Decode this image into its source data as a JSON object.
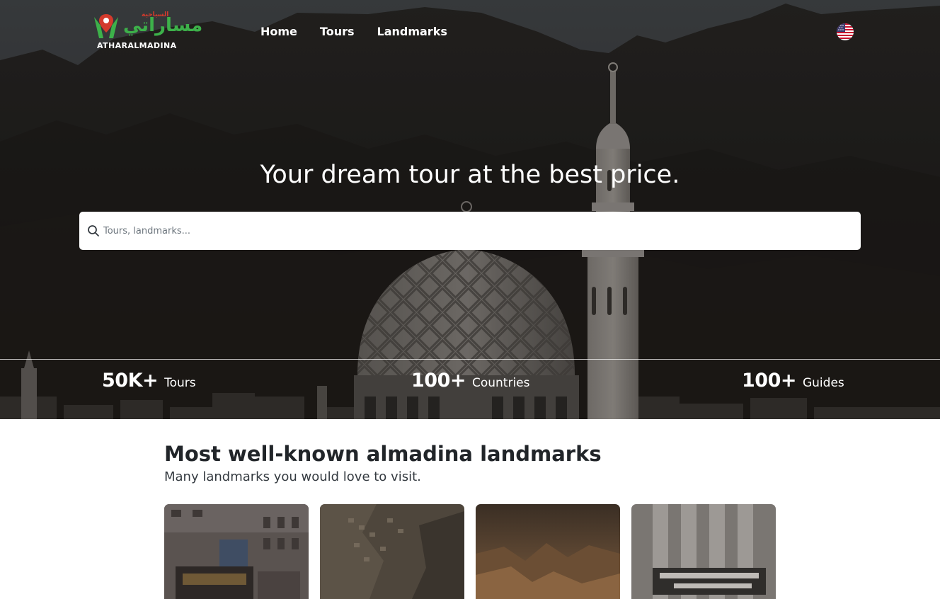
{
  "brand": {
    "name_ar": "مساراتي",
    "tagline_ar": "السياحية",
    "name_en": "ATHARALMADINA"
  },
  "nav": {
    "links": [
      "Home",
      "Tours",
      "Landmarks"
    ],
    "language_icon": "us-flag-icon"
  },
  "hero": {
    "title": "Your dream tour at the best price.",
    "search_placeholder": "Tours, landmarks..."
  },
  "stats": [
    {
      "value": "50K+",
      "label": "Tours"
    },
    {
      "value": "100+",
      "label": "Countries"
    },
    {
      "value": "100+",
      "label": "Guides"
    }
  ],
  "landmarks": {
    "title": "Most well-known almadina landmarks",
    "subtitle": "Many landmarks you would love to visit."
  },
  "colors": {
    "brand_green": "#3db14a",
    "brand_red": "#d33a2c",
    "hero_overlay": "#1e1d1c"
  }
}
